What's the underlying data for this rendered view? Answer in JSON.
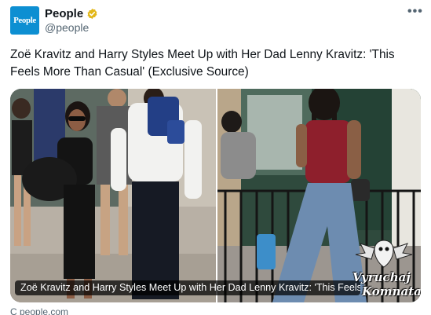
{
  "account": {
    "avatar_text": "People",
    "name": "People",
    "handle": "@people",
    "verified_icon": "verified-gold-badge-icon",
    "more_label": "•••"
  },
  "tweet": {
    "text": "Zoë Kravitz and Harry Styles Meet Up with Her Dad Lenny Kravitz: 'This Feels More Than Casual' (Exclusive Source)"
  },
  "card": {
    "headline": "Zoë Kravitz and Harry Styles Meet Up with Her Dad Lenny Kravitz: 'This Feels",
    "source": "C people.com",
    "watermark_line1": "Vyruchaj",
    "watermark_line2": "Komnata"
  },
  "colors": {
    "brand": "#0d8fd2",
    "verified": "#e2b719",
    "text_primary": "#0f1419",
    "text_secondary": "#536471"
  }
}
